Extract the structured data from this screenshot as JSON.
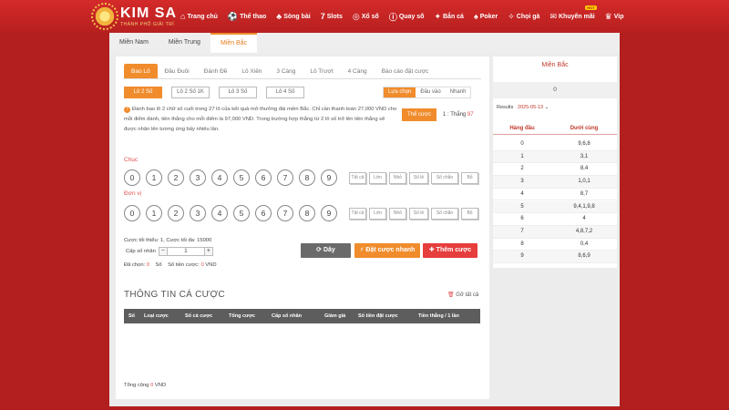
{
  "brand": {
    "name": "KIM SA",
    "tagline": "THÀNH PHỐ GIẢI TRÍ"
  },
  "nav": [
    {
      "label": "Trang chủ",
      "icon": "home-icon",
      "glyph": "⌂"
    },
    {
      "label": "Thể thao",
      "icon": "soccer-ball-icon",
      "glyph": "⚽"
    },
    {
      "label": "Sòng bài",
      "icon": "casino-icon",
      "glyph": "♣"
    },
    {
      "label": "Slots",
      "icon": "slots-icon",
      "glyph": "7"
    },
    {
      "label": "Xổ số",
      "icon": "lottery-icon",
      "glyph": "◎"
    },
    {
      "label": "Quay số",
      "icon": "spin-icon",
      "glyph": "ⓘ"
    },
    {
      "label": "Bắn cá",
      "icon": "fish-icon",
      "glyph": "✦"
    },
    {
      "label": "Poker",
      "icon": "poker-icon",
      "glyph": "♠"
    },
    {
      "label": "Chọi gà",
      "icon": "rooster-icon",
      "glyph": "✧"
    },
    {
      "label": "Khuyến mãi",
      "icon": "gift-icon",
      "glyph": "✉",
      "badge": "HOT"
    },
    {
      "label": "Vip",
      "icon": "crown-icon",
      "glyph": "♛"
    }
  ],
  "regions": [
    "Miền Nam",
    "Miền Trung",
    "Miền Bắc"
  ],
  "bet_tabs": [
    "Bao Lô",
    "Đầu Đuôi",
    "Đánh Đề",
    "Lô Xiên",
    "3 Càng",
    "Lô Trượt",
    "4 Càng",
    "Báo cáo đặt cược"
  ],
  "sub_types": [
    "Lô 2 Số",
    "Lô 2 Số 1K",
    "Lô 3 Số",
    "Lô 4 Số"
  ],
  "modes": [
    "Lựa chọn",
    "Đầu vào",
    "Nhanh"
  ],
  "description": "Đánh bao lô 2 chữ số cuối trong 27 lô của kết quả mở thưởng đài miền Bắc. Chỉ cần thanh toán 27,000 VND cho mỗi điểm đánh, tiền thắng cho mỗi điểm là 97,000 VND. Trong trường hợp thắng từ 2 lô số trở lên tiền thắng sẽ được nhân lên tương ứng bấy nhiêu lần.",
  "rule_button": "Thể cược",
  "ratio": {
    "prefix": "1 : Thắng",
    "value": "97"
  },
  "rows": [
    {
      "label": "Chục",
      "numbers": [
        "0",
        "1",
        "2",
        "3",
        "4",
        "5",
        "6",
        "7",
        "8",
        "9"
      ]
    },
    {
      "label": "Đơn vị",
      "numbers": [
        "0",
        "1",
        "2",
        "3",
        "4",
        "5",
        "6",
        "7",
        "8",
        "9"
      ]
    }
  ],
  "quick_picks": [
    "Tất cả",
    "Lớn",
    "Nhỏ",
    "Số lẻ",
    "Số chẵn",
    "Bỏ"
  ],
  "limits": "Cược tối thiểu: 1, Cược tối đa: 15000",
  "multiplier": {
    "label": "Cấp số nhân",
    "value": "1",
    "minus": "−",
    "plus": "+"
  },
  "selected": {
    "label": "Đã chọn:",
    "count": "0",
    "unit": "Số",
    "amount_label": "Số tiền cược:",
    "amount": "0",
    "currency": "VND"
  },
  "actions": {
    "clear": "⟳ Dây",
    "fast": "⚡ Đặt cược nhanh",
    "add": "✚ Thêm cược"
  },
  "bet_info": {
    "title": "THÔNG TIN CÁ CƯỢC",
    "clear_all": "Gỡ tất cả",
    "columns": [
      "Số",
      "Loại cược",
      "Số cá cược",
      "Tổng cược",
      "Cấp số nhân",
      "Giảm giá",
      "Số tiền đặt cược",
      "Tiền thắng / 1 lần"
    ]
  },
  "total": {
    "label": "Tổng cộng",
    "value": "0",
    "currency": "VND"
  },
  "side": {
    "title": "Miền Bắc",
    "zero": "0",
    "results_label": "Results",
    "date": "2025-05-13",
    "head_col1": "Hàng đầu",
    "head_col2": "Dưới cùng",
    "rows": [
      {
        "head": "0",
        "tail": "9,6,8"
      },
      {
        "head": "1",
        "tail": "3,1"
      },
      {
        "head": "2",
        "tail": "8,4"
      },
      {
        "head": "3",
        "tail": "1,0,1"
      },
      {
        "head": "4",
        "tail": "8,7"
      },
      {
        "head": "5",
        "tail": "9,4,1,9,8"
      },
      {
        "head": "6",
        "tail": "4"
      },
      {
        "head": "7",
        "tail": "4,8,7,2"
      },
      {
        "head": "8",
        "tail": "0,4"
      },
      {
        "head": "9",
        "tail": "8,6,9"
      }
    ]
  }
}
